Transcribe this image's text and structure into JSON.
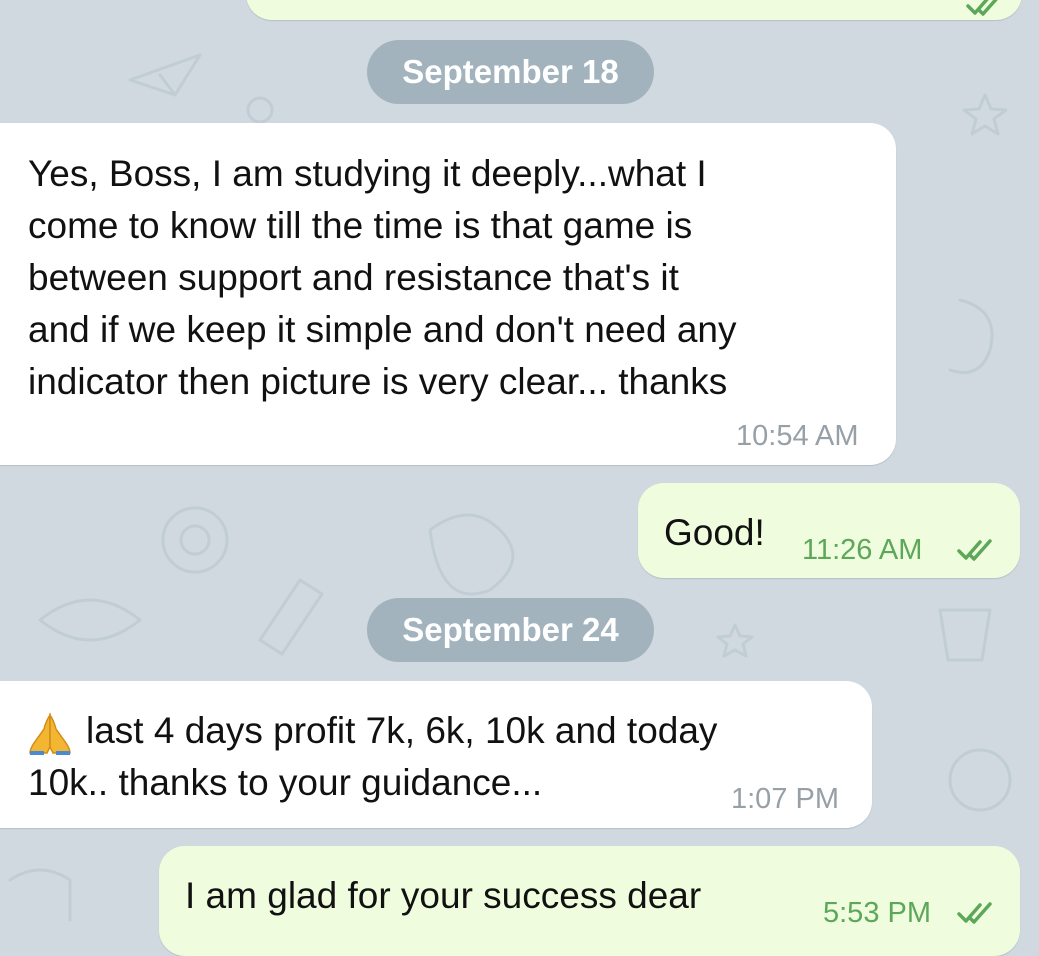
{
  "messages": {
    "top_partial": {
      "direction": "outgoing",
      "read_icon": "double-check-icon"
    },
    "date1": "September 18",
    "msg1": {
      "text": "Yes, Boss, I am studying it deeply...what I\ncome to know till the time is that game is\nbetween support and resistance that's it\nand if we keep it simple and don't need any\nindicator then picture is very clear... thanks",
      "time": "10:54 AM"
    },
    "msg2": {
      "text": "Good!",
      "time": "11:26 AM",
      "read_icon": "double-check-icon"
    },
    "date2": "September 24",
    "msg3": {
      "emoji_icon": "folded-hands-icon",
      "text": "last 4 days profit 7k, 6k, 10k and today\n10k.. thanks to your guidance...",
      "time": "1:07 PM"
    },
    "msg4": {
      "text": "I am glad for your success dear",
      "time": "5:53 PM",
      "read_icon": "double-check-icon"
    }
  },
  "colors": {
    "background": "#cfd9df",
    "incoming_bubble": "#ffffff",
    "outgoing_bubble": "#effdde",
    "outgoing_time": "#5ea75a",
    "incoming_time": "#98a0a7",
    "date_pill": "#96a8b4"
  }
}
